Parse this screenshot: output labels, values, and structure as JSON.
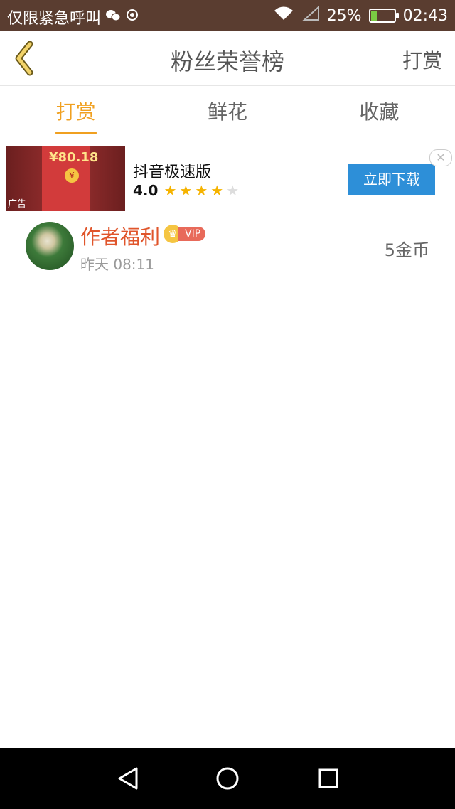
{
  "status_bar": {
    "carrier_text": "仅限紧急呼叫",
    "battery_percent": "25%",
    "battery_level": 0.25,
    "time": "02:43",
    "icons": [
      "wechat-icon",
      "location-icon",
      "wifi-icon",
      "signal-icon",
      "battery-icon"
    ]
  },
  "header": {
    "title": "粉丝荣誉榜",
    "action_label": "打赏",
    "back_icon": "chevron-left-icon"
  },
  "tabs": [
    {
      "label": "打赏",
      "active": true
    },
    {
      "label": "鲜花",
      "active": false
    },
    {
      "label": "收藏",
      "active": false
    }
  ],
  "ad": {
    "thumb_amount": "¥80.18",
    "thumb_coin": "¥",
    "thumb_label": "广告",
    "app_name": "抖音极速版",
    "rating_text": "4.0",
    "rating_value": 4,
    "rating_max": 5,
    "cta_label": "立即下载",
    "close_glyph": "✕"
  },
  "fans": [
    {
      "name": "作者福利",
      "badge": "VIP",
      "time": "昨天 08:11",
      "amount": "5金币"
    }
  ],
  "colors": {
    "accent": "#f0a020",
    "status_bar": "#5a3d30",
    "name": "#e0552b",
    "cta": "#2d8fd8"
  }
}
